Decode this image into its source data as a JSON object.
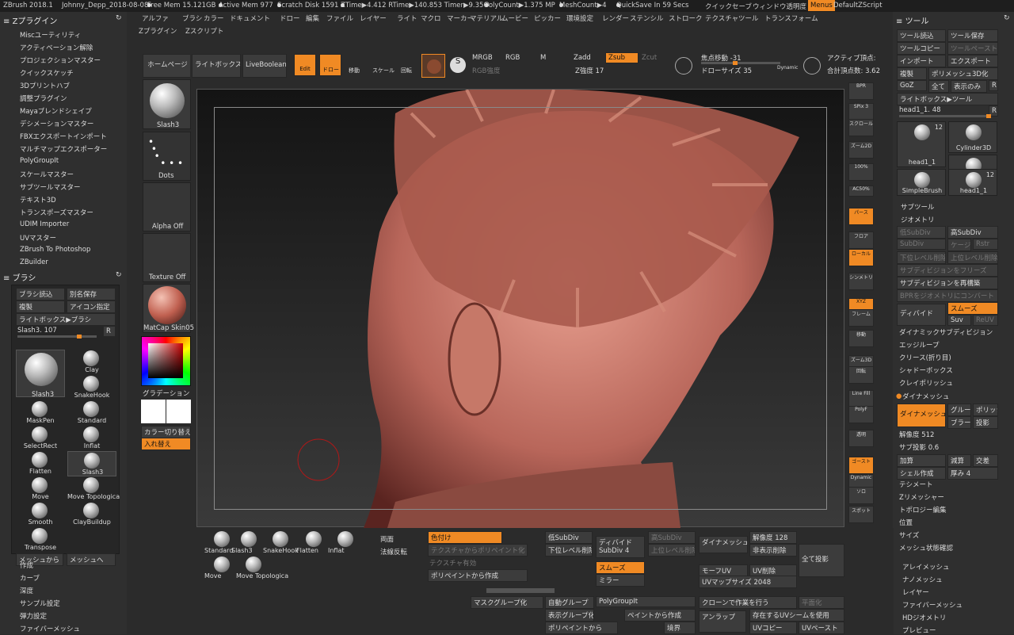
{
  "topbar": {
    "app": "ZBrush 2018.1",
    "project": "Johnny_Depp_2018-08-08",
    "free_mem": "Free Mem 15.121GB",
    "active_mem": "Active Mem 977",
    "scratch": "Scratch Disk 1591",
    "ztime": "ZTime▶4.412 RTime▶140.853 Timer▶9.356",
    "polycount": "PolyCount▶1.375 MP",
    "meshcount": "MeshCount▶4",
    "quicksave": "QuickSave In 59 Secs",
    "quicksave_btn": "クイックセーブ",
    "window_transparency": "ウィンドウ透明度",
    "menus": "Menus",
    "script": "DefaultZScript"
  },
  "menu": [
    "アルファ",
    "ブラシ",
    "カラー",
    "ドキュメント",
    "ドロー",
    "編集",
    "ファイル",
    "レイヤー",
    "ライト",
    "マクロ",
    "マーカー",
    "マテリアル",
    "ムービー",
    "ピッカー",
    "環境設定",
    "レンダー",
    "ステンシル",
    "ストローク",
    "テクスチャ",
    "ツール",
    "トランスフォーム"
  ],
  "menu2": [
    "Zプラグイン",
    "Zスクリプト"
  ],
  "zplugin": {
    "title": "Zプラグイン",
    "items": [
      "Miscユーティリティ",
      "アクティベーション解除",
      "プロジェクションマスター",
      "クイックスケッチ",
      "3Dプリントハブ",
      "調整プラグイン",
      "Mayaブレンドシェイプ",
      "デシメーションマスター",
      "FBXエクスポートインポート",
      "マルチマップエクスポーター",
      "PolyGroupIt",
      "スケールマスター",
      "サブツールマスター",
      "テキスト3D",
      "トランスポーズマスター",
      "UDIM Importer",
      "UVマスター",
      "ZBrush To Photoshop",
      "ZBuilder"
    ]
  },
  "brush": {
    "title": "ブラシ",
    "load": "ブラシ読込",
    "save_as": "別名保存",
    "copy": "複製",
    "icon": "アイコン指定",
    "lightbox": "ライトボックス▶ブラシ",
    "slider": "Slash3. 107",
    "r": "R",
    "current": "Slash3",
    "brushes": [
      "Clay",
      "SnakeHook",
      "MaskPen",
      "Standard",
      "SelectRect",
      "Inflat",
      "Flatten",
      "Slash3",
      "Move",
      "Move Topologica",
      "Smooth",
      "ClayBuildup",
      "Transpose"
    ],
    "from_mesh": "メッシュから",
    "to_mesh": "メッシュへ"
  },
  "left_bottom": [
    "作成",
    "カーブ",
    "深度",
    "サンプル設定",
    "弾力設定",
    "ファイバーメッシュ"
  ],
  "shelf": {
    "slash3": "Slash3",
    "dots": "Dots",
    "alpha": "Alpha Off",
    "texture": "Texture Off",
    "matcap": "MatCap Skin05",
    "gradient": "グラデーション",
    "switch": "カラー切り替え",
    "swap": "入れ替え"
  },
  "toolbar": {
    "home": "ホームページ",
    "lightbox": "ライトボックス",
    "liveboolean": "LiveBoolean",
    "edit": "Edit",
    "draw": "ドロー",
    "move": "移動",
    "scale": "スケール",
    "rotate": "回転",
    "mrgb": "MRGB",
    "rgb": "RGB",
    "m": "M",
    "rgb_intensity": "RGB強度",
    "zadd": "Zadd",
    "zsub": "Zsub",
    "zcut": "Zcut",
    "z_intensity": "Z強度 17",
    "focal": "焦点移動 -31",
    "draw_size": "ドローサイズ 35",
    "dynamic": "Dynamic",
    "active_points": "アクティブ頂点:",
    "total_points": "合計頂点数: 3.62"
  },
  "right_shelf": [
    "BPR",
    "SPix 3",
    "スクロール",
    "ズーム2D",
    "100%",
    "AC50%",
    "パース",
    "フロア",
    "ローカル",
    "シンメトリ",
    "XYZ",
    "フレーム",
    "移動",
    "ズーム3D",
    "回転",
    "Line Fill",
    "PolyF",
    "透明",
    "ゴースト",
    "Dynamic",
    "ソロ",
    "スポット"
  ],
  "tool": {
    "title": "ツール",
    "load": "ツール読込",
    "save": "ツール保存",
    "copy": "ツールコピー",
    "paste": "ツールペースト",
    "import": "インポート",
    "export": "エクスポート",
    "clone": "複製",
    "polymesh3d": "ポリメッシュ3D化",
    "goz": "GoZ",
    "all": "全て",
    "visible": "表示のみ",
    "r": "R",
    "lightbox": "ライトボックス▶ツール",
    "slider": "head1_1. 48",
    "thumbs": [
      {
        "name": "head1_1",
        "count": "12"
      },
      {
        "name": "Cylinder3D",
        "count": ""
      },
      {
        "name": "PolyMesh3D",
        "count": ""
      },
      {
        "name": "SimpleBrush",
        "count": ""
      },
      {
        "name": "head1_1",
        "count": "12"
      }
    ],
    "subtool": "サブツール",
    "geometry": "ジオメトリ",
    "lower": "低SubDiv",
    "higher": "高SubDiv",
    "subdiv": "SubDiv",
    "cage": "ケージ",
    "rstr": "Rstr",
    "del_lower": "下位レベル削除",
    "del_higher": "上位レベル削除",
    "freeze": "サブディビジョンをフリーズ",
    "reconstruct": "サブディビジョンを再構築",
    "bpr_geo": "BPRをジオメトリにコンバート",
    "divide": "ディバイド",
    "smooth": "スムーズ",
    "suv": "Suv",
    "reuv": "ReUV",
    "dyn_subdiv": "ダイナミックサブディビジョン",
    "edgeloop": "エッジループ",
    "crease": "クリース(折り目)",
    "shadowbox": "シャドーボックス",
    "claypolish": "クレイポリッシュ",
    "dynamesh": "ダイナメッシュ",
    "dynamesh_btn": "ダイナメッシュ",
    "group": "グループ",
    "polish": "ポリッシュ",
    "blur": "ブラー",
    "project": "投影",
    "resolution": "解像度 512",
    "subproj": "サブ投影 0.6",
    "add": "加算",
    "subtract": "減算",
    "intersect": "交差",
    "shell": "シェル作成",
    "thickness": "厚み 4",
    "tessimate": "テシメート",
    "zremesher": "Zリメッシャー",
    "topology": "トポロジー編集",
    "position": "位置",
    "size": "サイズ",
    "meshintegrity": "メッシュ状態確認",
    "arraymesh": "アレイメッシュ",
    "nanomesh": "ナノメッシュ",
    "layers": "レイヤー",
    "fibermesh": "ファイバーメッシュ",
    "hd": "HDジオメトリ",
    "preview": "プレビュー"
  },
  "bottom": {
    "brushes": [
      "Standard",
      "Slash3",
      "SnakeHook",
      "Flatten",
      "Inflat",
      "Move",
      "Move Topologica"
    ],
    "double": "両面",
    "flip": "法線反転",
    "colorize": "色付け",
    "tex_from_poly": "テクスチャからポリペイント化",
    "tex_on": "テクスチャ有効",
    "polypaint_make": "ポリペイントから作成",
    "lower": "低SubDiv",
    "del_higher": "下位レベル削除",
    "divide": "ディバイド",
    "subdiv4": "SubDiv 4",
    "higher": "高SubDiv",
    "del_up": "上位レベル削除",
    "smooth": "スムーズ",
    "mirror": "ミラー",
    "dynamesh": "ダイナメッシュ",
    "res": "解像度 128",
    "del_hidden": "非表示削除",
    "proj_all": "全て投影",
    "morph_uv": "モーフUV",
    "uv_del": "UV削除",
    "uv_size": "UVマップサイズ 2048",
    "mask_group": "マスクグループ化",
    "auto_group": "自動グループ",
    "polygroupit": "PolyGroupIt",
    "group_vis": "表示グループ化",
    "from_paint": "ペイントから作成",
    "from_polypaint": "ポリペイントから",
    "border": "境界",
    "crown": "クローンで作業を行う",
    "flatten": "平面化",
    "unwrap": "アンラップ",
    "uv_exist": "存在するUVシームを使用",
    "uv_copy": "UVコピー",
    "uv_paste": "UVペースト"
  }
}
